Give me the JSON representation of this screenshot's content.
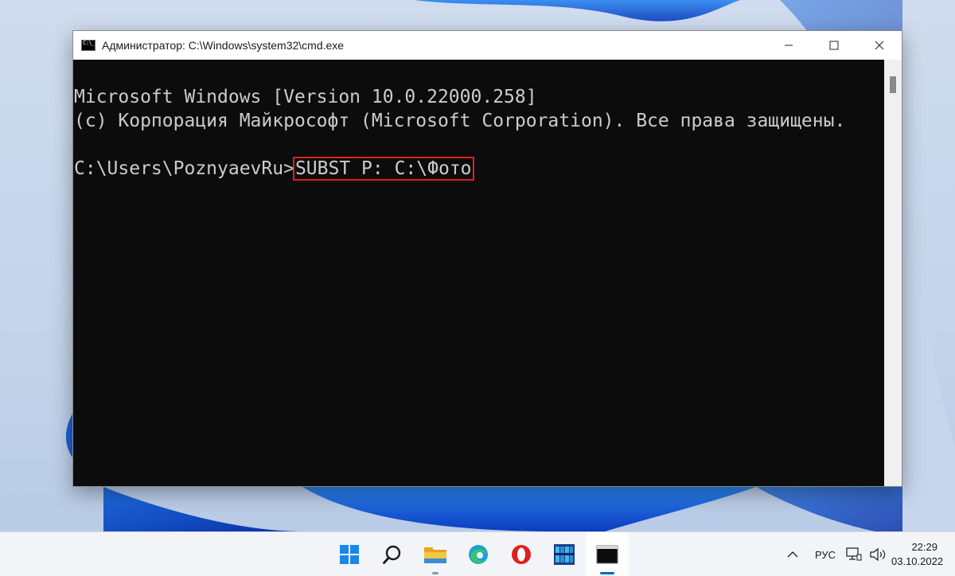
{
  "window": {
    "title": "Администратор: C:\\Windows\\system32\\cmd.exe"
  },
  "console": {
    "line1": "Microsoft Windows [Version 10.0.22000.258]",
    "line2": "(c) Корпорация Майкрософт (Microsoft Corporation). Все права защищены.",
    "prompt": "C:\\Users\\PoznyaevRu>",
    "command": "SUBST P: C:\\Фото"
  },
  "taskbar": {
    "apps": [
      "start-icon",
      "search-icon",
      "file-explorer-icon",
      "edge-icon",
      "opera-icon",
      "app-icon",
      "cmd-icon"
    ],
    "language": "РУС",
    "time": "22:29",
    "date": "03.10.2022"
  },
  "colors": {
    "console_bg": "#0c0c0c",
    "console_text": "#cccccc",
    "highlight": "#e01e1e",
    "accent": "#0067c0"
  }
}
